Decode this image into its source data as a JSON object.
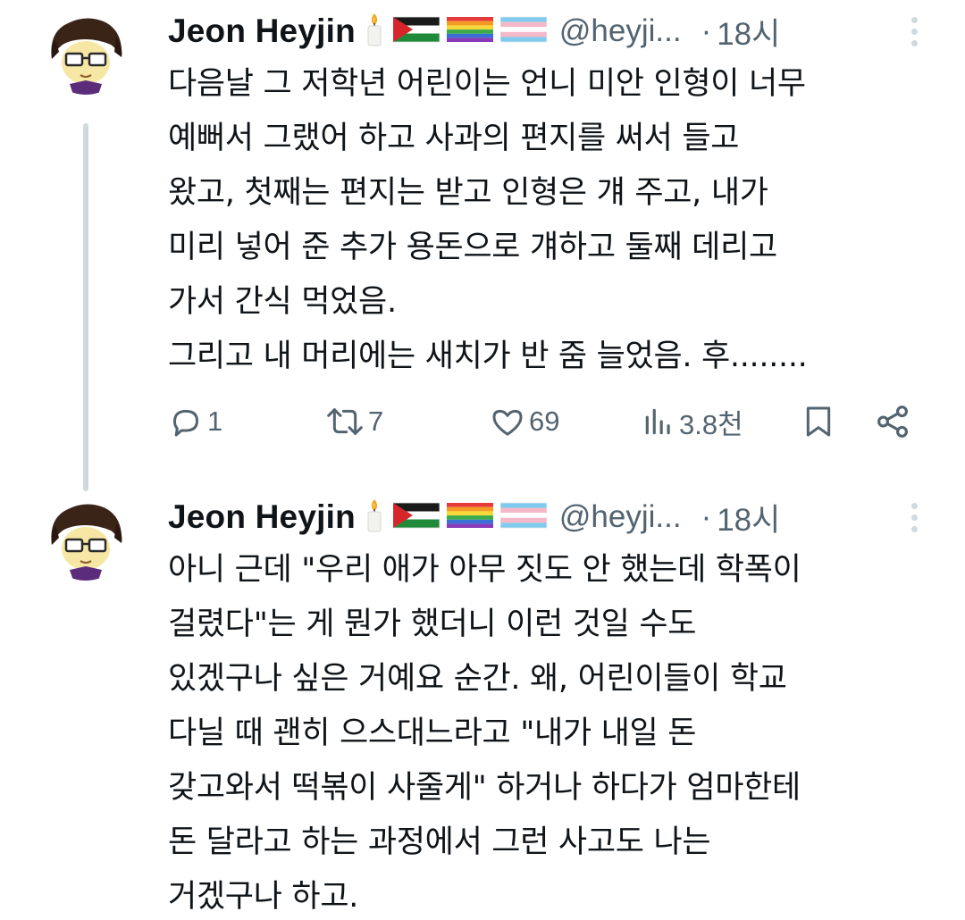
{
  "colors": {
    "text_primary": "#0f1419",
    "text_secondary": "#536471",
    "thread_line": "#cfd9de"
  },
  "tweets": [
    {
      "author": {
        "display_name": "Jeon Heyjin",
        "emoji_icons": [
          "candle-emoji",
          "palestine-flag-emoji",
          "rainbow-flag-emoji",
          "transgender-flag-emoji"
        ],
        "handle": "@heyji...",
        "separator": "·",
        "time": "18시"
      },
      "lines": [
        "다음날 그 저학년 어린이는 언니 미안 인형이 너무",
        "예뻐서 그랬어 하고 사과의 편지를 써서 들고",
        "왔고, 첫째는 편지는 받고 인형은 걔 주고, 내가",
        "미리 넣어 준 추가 용돈으로 걔하고 둘째 데리고",
        "가서 간식 먹었음.",
        "그리고 내 머리에는 새치가 반 줌 늘었음. 후........"
      ],
      "actions": {
        "reply_count": "1",
        "retweet_count": "7",
        "like_count": "69",
        "view_count": "3.8천"
      }
    },
    {
      "author": {
        "display_name": "Jeon Heyjin",
        "emoji_icons": [
          "candle-emoji",
          "palestine-flag-emoji",
          "rainbow-flag-emoji",
          "transgender-flag-emoji"
        ],
        "handle": "@heyji...",
        "separator": "·",
        "time": "18시"
      },
      "lines": [
        "아니 근데 \"우리 애가 아무 짓도 안 했는데 학폭이",
        "걸렸다\"는 게 뭔가 했더니 이런 것일 수도",
        "있겠구나 싶은 거예요 순간. 왜, 어린이들이 학교",
        "다닐 때 괜히 으스대느라고 \"내가 내일 돈",
        "갖고와서 떡볶이 사줄게\" 하거나 하다가 엄마한테",
        "돈 달라고 하는 과정에서 그런 사고도 나는",
        "거겠구나 하고."
      ]
    }
  ]
}
